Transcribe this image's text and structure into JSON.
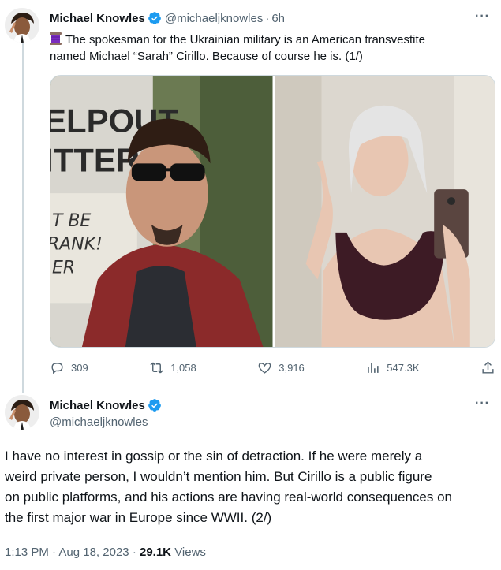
{
  "tweet1": {
    "author_name": "Michael Knowles",
    "handle": "@michaeljknowles",
    "separator": "·",
    "time": "6h",
    "text_line1": "The spokesman for the Ukrainian military is an American transvestite",
    "text_line2": "named Michael “Sarah” Cirillo. Because of course he is. (1/)",
    "leading_emoji": "spool-of-thread-icon",
    "media": [
      {
        "sign_text": [
          "ELPOUT",
          "ITTER"
        ],
        "handwritten": [
          "T BE",
          "RANK!",
          "ER"
        ]
      },
      {}
    ],
    "actions": {
      "replies": "309",
      "retweets": "1,058",
      "likes": "3,916",
      "views": "547.3K"
    }
  },
  "tweet2": {
    "author_name": "Michael Knowles",
    "handle": "@michaeljknowles",
    "text_line1": "I have no interest in gossip or the sin of detraction. If he were merely a",
    "text_line2": "weird private person, I wouldn’t mention him. But Cirillo is a public figure",
    "text_line3": "on public platforms, and his actions are having real-world consequences on",
    "text_line4": "the first major war in Europe since WWII. (2/)",
    "time": "1:13 PM",
    "sep1": "·",
    "date": "Aug 18, 2023",
    "sep2": "·",
    "views_count": "29.1K",
    "views_label": "Views"
  },
  "more_label": "···",
  "colors": {
    "verified": "#1d9bf0",
    "secondary_text": "#536471",
    "primary_text": "#0f1419",
    "thread_line": "#cfd9de"
  }
}
